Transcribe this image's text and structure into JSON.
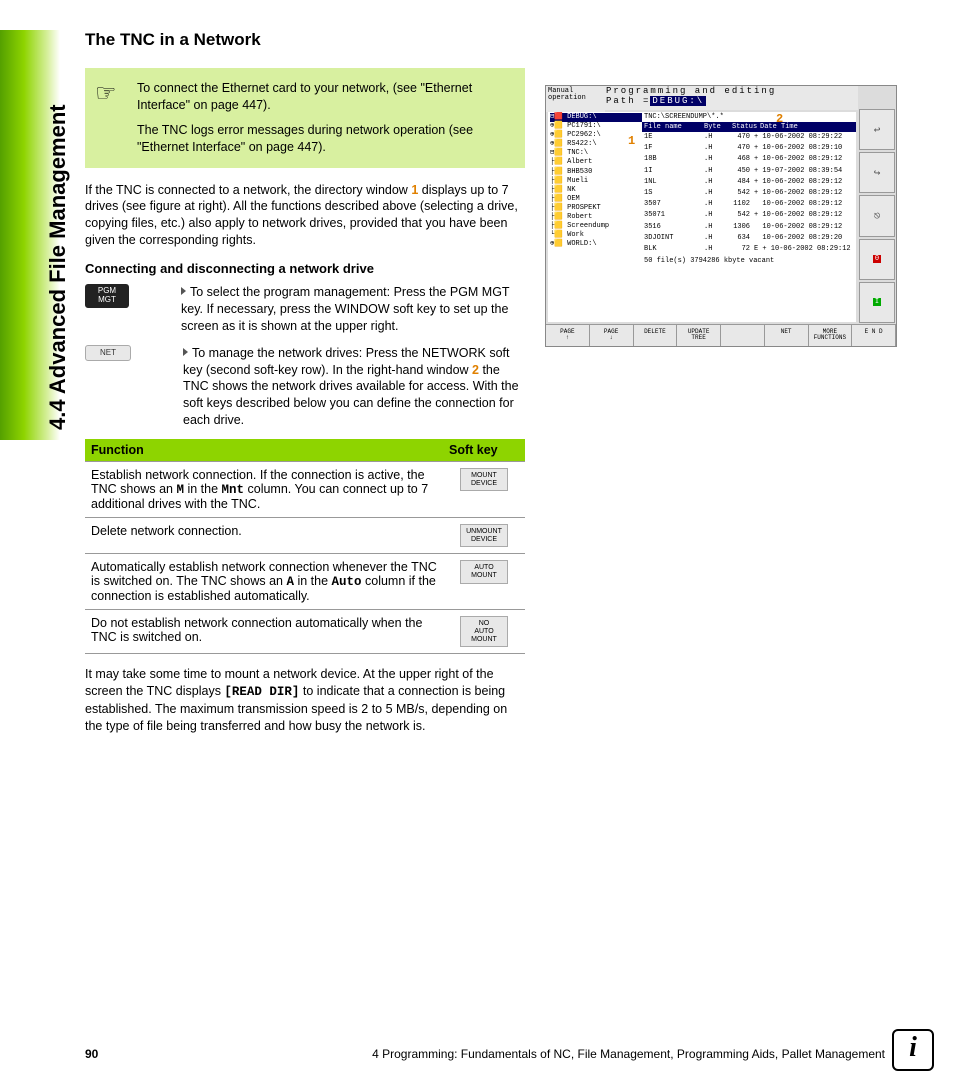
{
  "side_label": "4.4 Advanced File Management",
  "heading": "The TNC in a Network",
  "note": {
    "p1": "To connect the Ethernet card to your network, (see \"Ethernet Interface\" on page 447).",
    "p2": "The TNC logs error messages during network operation (see \"Ethernet Interface\" on page 447)."
  },
  "para1_a": "If the TNC is connected to a network, the directory window ",
  "para1_num": "1",
  "para1_b": " displays up to 7 drives (see figure at right). All the functions described above (selecting a drive, copying files, etc.) also apply to network drives, provided that you have been given the corresponding rights.",
  "subheading": "Connecting and disconnecting a network drive",
  "steps": [
    {
      "key": "PGM\nMGT",
      "key_style": "dark",
      "text": "To select the program management: Press the PGM MGT key. If necessary, press the WINDOW soft key to set up the screen as it is shown at the upper right."
    },
    {
      "key": "NET",
      "key_style": "light",
      "text_a": "To manage the network drives: Press the NETWORK soft key (second soft-key row). In the right-hand window ",
      "num": "2",
      "text_b": " the TNC shows the network drives available for access. With the soft keys described below you can define the connection for each drive."
    }
  ],
  "table": {
    "col1": "Function",
    "col2": "Soft key",
    "rows": [
      {
        "f_a": "Establish network connection. If the connection is active, the TNC shows an ",
        "m1": "M",
        "f_b": " in the ",
        "m2": "Mnt",
        "f_c": " column. You can connect up to 7 additional drives with the TNC.",
        "k": "MOUNT\nDEVICE"
      },
      {
        "f": "Delete network connection.",
        "k": "UNMOUNT\nDEVICE"
      },
      {
        "f_a": "Automatically establish network connection whenever the TNC is switched on. The TNC shows an ",
        "m1": "A",
        "f_b": " in the ",
        "m2": "Auto",
        "f_c": " column if the connection is established automatically.",
        "k": "AUTO\nMOUNT"
      },
      {
        "f": "Do not establish network connection automatically when the TNC is switched on.",
        "k": "NO\nAUTO\nMOUNT"
      }
    ]
  },
  "para2_a": "It may take some time to mount a network device. At the upper right of the screen the TNC displays ",
  "para2_mono": "[READ DIR]",
  "para2_b": " to indicate that a connection is being established. The maximum transmission speed is 2 to 5 MB/s, depending on the type of file being transferred and how busy the network is.",
  "footer": {
    "page": "90",
    "chapter": "4 Programming: Fundamentals of NC, File Management, Programming Aids, Pallet Management"
  },
  "screenshot": {
    "mode": "Manual operation",
    "title": "Programming and editing",
    "path_label": "Path =",
    "path_val": "DEBUG:\\",
    "dir_label": "TNC:\\SCREENDUMP\\*.*",
    "callout1": "1",
    "callout2": "2",
    "hdr": [
      "File name",
      "Byte",
      "Status",
      "Date      Time"
    ],
    "drives": [
      "⊟🟥 DEBUG:\\",
      "⊕🟨 PC1791:\\",
      "⊕🟨 PC2962:\\",
      "⊕🟨 RS422:\\",
      "⊟🟨 TNC:\\",
      " ├🟨 Albert",
      " ├🟨 BHB530",
      " ├🟨 Mueli",
      " ├🟨 NK",
      " ├🟨 OEM",
      " ├🟨 PROSPEKT",
      " ├🟨 Robert",
      " ├🟨 Screendump",
      " └🟨 Work",
      "⊕🟨 WORLD:\\"
    ],
    "rows": [
      [
        "1E",
        ".H",
        "470",
        "+ 10-06-2002 08:29:22"
      ],
      [
        "1F",
        ".H",
        "470",
        "+ 10-06-2002 08:29:10"
      ],
      [
        "18B",
        ".H",
        "468",
        "+ 10-06-2002 08:29:12"
      ],
      [
        "1I",
        ".H",
        "450",
        "+ 19-07-2002 08:39:54"
      ],
      [
        "1NL",
        ".H",
        "484",
        "+ 10-06-2002 08:29:12"
      ],
      [
        "1S",
        ".H",
        "542",
        "+ 10-06-2002 08:29:12"
      ],
      [
        "3507",
        ".H",
        "1102",
        "  10-06-2002 08:29:12"
      ],
      [
        "35071",
        ".H",
        "542",
        "+ 10-06-2002 08:29:12"
      ],
      [
        "3516",
        ".H",
        "1306",
        "  10-06-2002 08:29:12"
      ],
      [
        "3DJOINT",
        ".H",
        "634",
        "  10-06-2002 08:29:20"
      ],
      [
        "BLK",
        ".H",
        "72",
        "E + 10-06-2002 08:29:12"
      ]
    ],
    "status_line": "50  file(s) 3794286 kbyte vacant",
    "softkeys": [
      "PAGE\n↑",
      "PAGE\n↓",
      "DELETE\n",
      "UPDATE\nTREE",
      "",
      "NET",
      "MORE\nFUNCTIONS",
      "E N D"
    ]
  }
}
